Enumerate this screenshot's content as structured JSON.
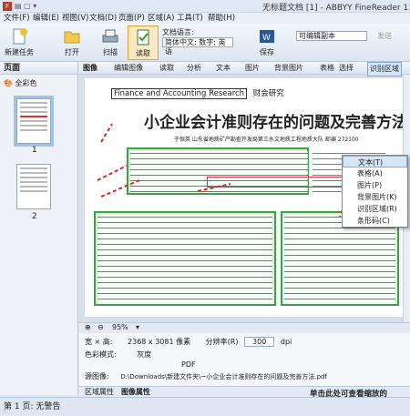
{
  "titlebar": {
    "title": "无标题文档 [1] - ABBYY FineReader 11 C"
  },
  "menu": [
    "文件(F)",
    "编辑(E)",
    "视图(V)",
    "文档(D)",
    "页面(P)",
    "区域(A)",
    "工具(T)",
    "帮助(H)"
  ],
  "ribbon": {
    "new_task": "新建任务",
    "open": "打开",
    "scan": "扫描",
    "read": "读取",
    "lang_label": "文档语言:",
    "lang_value": "简体中文; 数字; 英语",
    "save": "保存",
    "edit_mode": "可编辑副本",
    "send": "发送"
  },
  "left_pane": {
    "title": "页面",
    "color_mode": "全彩色",
    "pages": [
      "1",
      "2"
    ]
  },
  "image_toolbar": {
    "title": "图像",
    "items": [
      "编辑图像",
      "读取",
      "分析",
      "文本",
      "图片",
      "背景图片",
      "表格",
      "选择",
      "识别区域"
    ]
  },
  "document": {
    "journal": "Finance and Accounting Research",
    "journal_cn": "财会研究",
    "headline": "小企业会计准则存在的问题及完善方法",
    "byline": "于恒英    山东省地质矿产勘查开发局第三水文地质工程地质大队    邮编 272100"
  },
  "context_menu": {
    "items": [
      "文本(T)",
      "表格(A)",
      "图片(P)",
      "背景图片(K)",
      "识别区域(R)",
      "条形码(C)"
    ],
    "highlighted": 0
  },
  "zoom": {
    "value": "95%"
  },
  "properties": {
    "width_height_label": "宽 × 高:",
    "width_height": "2368 x 3081 像素",
    "resolution_label": "分辨率(R)",
    "resolution": "300",
    "resolution_unit": "dpi",
    "color_label": "色彩模式:",
    "color": "灰度",
    "format": "PDF",
    "source_label": "源图像:",
    "source": "D:\\Downloads\\新建文件夹\\~小企业会计准则存在的问题及完善方法.pdf"
  },
  "bottom_tabs": [
    "区域属性",
    "图像属性"
  ],
  "hint": "单击此处可查看缩放的",
  "status": "第 1 页: 无警告",
  "colors": {
    "accent": "#3ca24a",
    "highlight": "#d5e6fa",
    "arrow": "#d9262c"
  }
}
